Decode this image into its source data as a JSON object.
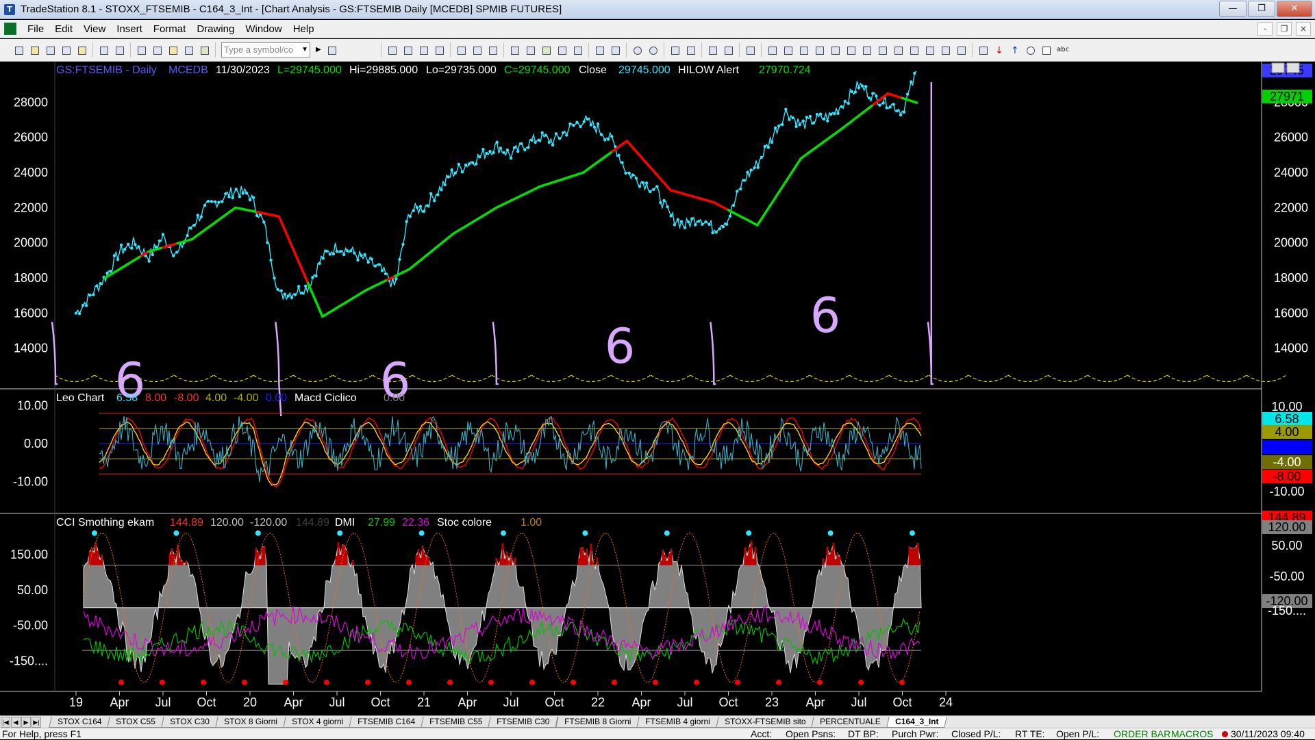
{
  "window": {
    "title": "TradeStation 8.1 - STOXX_FTSEMIB - C164_3_Int - [Chart Analysis - GS:FTSEMIB  Daily  [MCEDB] SPMIB FUTURES]",
    "app_icon": "tradestation-icon"
  },
  "menu": [
    "File",
    "Edit",
    "View",
    "Insert",
    "Format",
    "Drawing",
    "Window",
    "Help"
  ],
  "toolbar": {
    "symbol_placeholder": "Type a symbol/co"
  },
  "chart_data": [
    {
      "type": "line",
      "panel": "price",
      "header": {
        "symbol": "GS:FTSEMIB - Daily",
        "data": "MCEDB",
        "date": "11/30/2023",
        "L": "L=29745.000",
        "Hi": "Hi=29885.000",
        "Lo": "Lo=29735.000",
        "C": "C=29745.000",
        "close_label": "Close",
        "close_val": "29745.000",
        "hilow_label": "HILOW Alert",
        "hilow_val": "27970.724"
      },
      "ylim": [
        12000,
        30000
      ],
      "yticks": [
        "28000",
        "26000",
        "24000",
        "22000",
        "20000",
        "18000",
        "16000",
        "14000"
      ],
      "yvals": [
        28000,
        26000,
        24000,
        22000,
        20000,
        18000,
        16000,
        14000
      ],
      "price_series": {
        "name": "Close",
        "x": [
          "2019-01",
          "2019-02",
          "2019-03",
          "2019-04",
          "2019-05",
          "2019-06",
          "2019-07",
          "2019-08",
          "2019-09",
          "2019-10",
          "2019-11",
          "2019-12",
          "2020-01",
          "2020-02",
          "2020-03",
          "2020-04",
          "2020-05",
          "2020-06",
          "2020-07",
          "2020-08",
          "2020-09",
          "2020-10",
          "2020-11",
          "2020-12",
          "2021-01",
          "2021-02",
          "2021-03",
          "2021-04",
          "2021-05",
          "2021-06",
          "2021-07",
          "2021-08",
          "2021-09",
          "2021-10",
          "2021-11",
          "2021-12",
          "2022-01",
          "2022-02",
          "2022-03",
          "2022-04",
          "2022-05",
          "2022-06",
          "2022-07",
          "2022-08",
          "2022-09",
          "2022-10",
          "2022-11",
          "2022-12",
          "2023-01",
          "2023-02",
          "2023-03",
          "2023-04",
          "2023-05",
          "2023-06",
          "2023-07",
          "2023-08",
          "2023-09",
          "2023-10",
          "2023-11"
        ],
        "values": [
          16000,
          17000,
          18000,
          19500,
          20000,
          19200,
          20300,
          19300,
          21000,
          22000,
          22500,
          23000,
          22700,
          21000,
          17000,
          17200,
          17500,
          19200,
          19800,
          19500,
          19000,
          18500,
          17500,
          21800,
          22000,
          23000,
          24000,
          24500,
          25000,
          25500,
          25000,
          25600,
          26000,
          25800,
          26500,
          27000,
          26500,
          25800,
          24000,
          23500,
          23000,
          21500,
          21000,
          21500,
          20800,
          21400,
          23500,
          24500,
          26000,
          27500,
          26700,
          27000,
          27200,
          28000,
          29000,
          28300,
          28000,
          27500,
          29745
        ]
      },
      "hilow_series": {
        "name": "HILOW Alert",
        "x": [
          "2019-03",
          "2019-06",
          "2019-09",
          "2019-12",
          "2020-03",
          "2020-06",
          "2020-09",
          "2020-12",
          "2021-03",
          "2021-06",
          "2021-09",
          "2021-12",
          "2022-03",
          "2022-06",
          "2022-09",
          "2022-12",
          "2023-03",
          "2023-06",
          "2023-09",
          "2023-11"
        ],
        "values": [
          18000,
          19500,
          20200,
          22000,
          21500,
          15800,
          17300,
          18500,
          20500,
          22000,
          23200,
          24000,
          25800,
          23000,
          22300,
          21000,
          24800,
          26600,
          28500,
          27971
        ]
      },
      "annotations": [
        "6",
        "6",
        "6",
        "6"
      ],
      "right_labels": [
        {
          "text": "29745",
          "color": "#3a3aff"
        },
        {
          "text": "27971",
          "color": "#00d000"
        }
      ]
    },
    {
      "type": "line",
      "panel": "oscillator",
      "header": {
        "name": "Leo Chart",
        "v1": "6.58",
        "v2": "8.00",
        "v3": "-8.00",
        "v4": "4.00",
        "v5": "-4.00",
        "v6": "0.00",
        "name2": "Macd Ciclico",
        "v7": "0.00"
      },
      "ylim": [
        -17,
        13
      ],
      "yticks": [
        "10.00",
        "0.00",
        "-10.00"
      ],
      "yvals": [
        10,
        0,
        -10
      ],
      "levels": [
        8,
        4,
        0,
        -4,
        -8
      ],
      "series": [
        {
          "name": "Leo Chart",
          "value": 6.58
        },
        {
          "name": "Macd Ciclico",
          "value": 0.0
        }
      ],
      "right_labels": [
        {
          "text": "10.00",
          "bg": "#000",
          "fg": "#fff"
        },
        {
          "text": "6.58",
          "bg": "#00e6e6",
          "fg": "#000"
        },
        {
          "text": "4.00",
          "bg": "#9b9b00",
          "fg": "#000"
        },
        {
          "text": "0.00",
          "bg": "#0000ff",
          "fg": "#0000ff"
        },
        {
          "text": "-4.00",
          "bg": "#6f6f00",
          "fg": "#fff"
        },
        {
          "text": "-8.00",
          "bg": "#ff0000",
          "fg": "#000"
        },
        {
          "text": "-10.00",
          "bg": "#000",
          "fg": "#fff"
        }
      ]
    },
    {
      "type": "area",
      "panel": "cci",
      "header": {
        "name": "CCI Smothing ekam",
        "v1": "144.89",
        "v2": "120.00",
        "v3": "-120.00",
        "v4": "144.89",
        "name2": "DMI",
        "v5": "27.99",
        "v6": "22.36",
        "name3": "Stoc colore",
        "v7": "1.00"
      },
      "ylim": [
        -220,
        250
      ],
      "yticks": [
        "150.00",
        "50.00",
        "-50.00",
        "-150...."
      ],
      "yvals": [
        150,
        50,
        -50,
        -150
      ],
      "levels": [
        120,
        -120
      ],
      "series": [
        {
          "name": "CCI Smothing ekam",
          "value": 144.89
        },
        {
          "name": "DMI",
          "values": [
            27.99,
            22.36
          ]
        },
        {
          "name": "Stoc colore",
          "value": 1.0
        }
      ],
      "right_labels": [
        {
          "text": "144.89",
          "bg": "#ff0000",
          "fg": "#000"
        },
        {
          "text": "120.00",
          "bg": "#808080",
          "fg": "#000"
        },
        {
          "text": "50.00",
          "bg": "#000",
          "fg": "#fff"
        },
        {
          "text": "-50.00",
          "bg": "#000",
          "fg": "#fff"
        },
        {
          "text": "-120.00",
          "bg": "#808080",
          "fg": "#000"
        },
        {
          "text": "-150....",
          "bg": "#000",
          "fg": "#fff"
        }
      ]
    }
  ],
  "xaxis": {
    "labels": [
      "19",
      "Apr",
      "Jul",
      "Oct",
      "20",
      "Apr",
      "Jul",
      "Oct",
      "21",
      "Apr",
      "Jul",
      "Oct",
      "22",
      "Apr",
      "Jul",
      "Oct",
      "23",
      "Apr",
      "Jul",
      "Oct",
      "24"
    ],
    "dates": [
      "2019-01",
      "2019-04",
      "2019-07",
      "2019-10",
      "2020-01",
      "2020-04",
      "2020-07",
      "2020-10",
      "2021-01",
      "2021-04",
      "2021-07",
      "2021-10",
      "2022-01",
      "2022-04",
      "2022-07",
      "2022-10",
      "2023-01",
      "2023-04",
      "2023-07",
      "2023-10",
      "2024-01"
    ]
  },
  "tabs": [
    "STOX C164",
    "STOX C55",
    "STOX  C30",
    "STOX  8 Giorni",
    "STOX 4 giorni",
    "FTSEMIB C164",
    "FTSEMIB C55",
    "FTSEMIB C30",
    "FTSEMIB  8 Giorni",
    "FTSEMIB  4 giorni",
    "STOXX-FTSEMIB sito",
    "PERCENTUALE",
    "C164_3_Int"
  ],
  "active_tab": "C164_3_Int",
  "status": {
    "help": "For Help, press F1",
    "acct": "Acct:",
    "open_psns": "Open Psns:",
    "dt_bp": "DT BP:",
    "purch_pwr": "Purch Pwr:",
    "closed_pl": "Closed P/L:",
    "rt_te": "RT TE:",
    "open_pl": "Open P/L:",
    "order_bar": "ORDER BAR",
    "macros": "MACROS",
    "datetime": "30/11/2023 09:40"
  },
  "colors": {
    "price": "#33e6ff",
    "hilow_up": "#00e000",
    "hilow_down": "#ff0000",
    "cycle": "#d8a8ff",
    "arcs": "#e6e600",
    "macd": "#ffd400",
    "macd2": "#ff0000",
    "dmi_plus": "#00c000",
    "dmi_minus": "#e000e0",
    "cci_fill": "#808080",
    "cci_over": "#c00000"
  }
}
